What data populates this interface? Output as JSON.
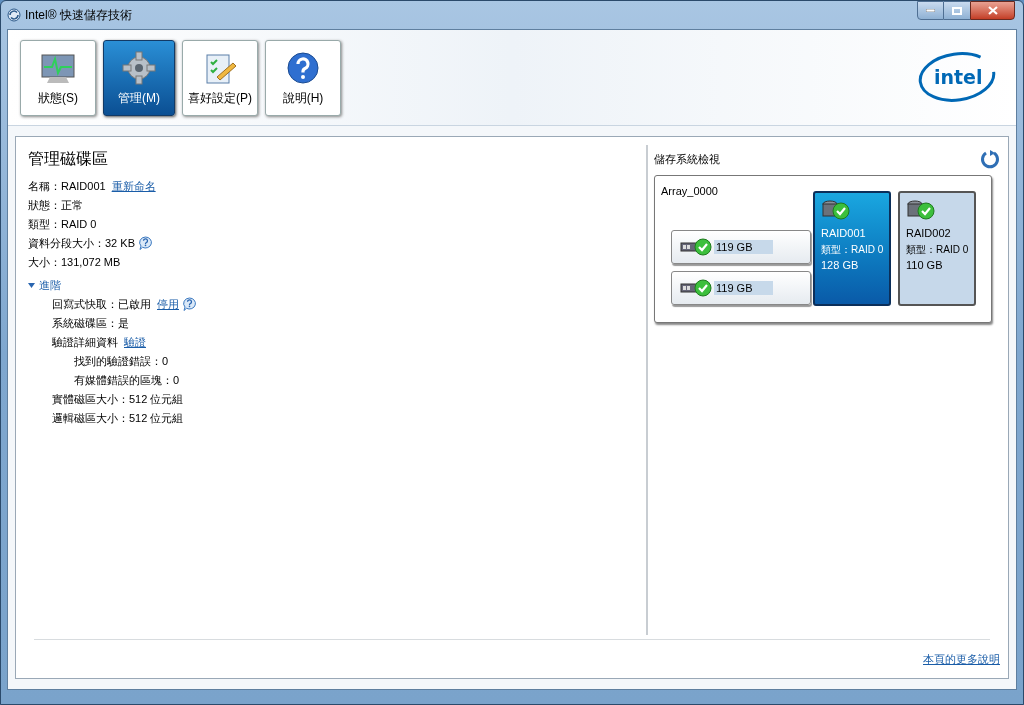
{
  "window": {
    "title": "Intel® 快速儲存技術"
  },
  "toolbar": [
    {
      "label": "狀態(S)",
      "kind": "monitor",
      "selected": false
    },
    {
      "label": "管理(M)",
      "kind": "gear",
      "selected": true
    },
    {
      "label": "喜好設定(P)",
      "kind": "clipboard",
      "selected": false
    },
    {
      "label": "說明(H)",
      "kind": "help",
      "selected": false
    }
  ],
  "volume_panel": {
    "title": "管理磁碟區",
    "rows": [
      {
        "text": "名稱：RAID001",
        "link": "重新命名",
        "help": false
      },
      {
        "text": "狀態：正常",
        "help": false
      },
      {
        "text": "類型：RAID 0",
        "help": false
      },
      {
        "text": "資料分段大小：32 KB",
        "help": true
      },
      {
        "text": "大小：131,072 MB",
        "help": false
      }
    ],
    "advanced": {
      "label": "進階",
      "expanded": true,
      "children": [
        {
          "text": "回寫式快取：已啟用",
          "link": "停用",
          "help": true
        },
        {
          "text": "系統磁碟區：是",
          "help": false
        },
        {
          "text": "驗證詳細資料",
          "link": "驗證",
          "help": false,
          "children": [
            {
              "text": "找到的驗證錯誤：0",
              "help": false
            },
            {
              "text": "有媒體錯誤的區塊：0",
              "help": false
            }
          ]
        },
        {
          "text": "實體磁區大小：512 位元組",
          "help": false
        },
        {
          "text": "邏輯磁區大小：512 位元組",
          "help": false
        }
      ]
    }
  },
  "storage_view": {
    "title": "儲存系統檢視",
    "array": {
      "name": "Array_0000",
      "disks": [
        {
          "size": "119 GB"
        },
        {
          "size": "119 GB"
        }
      ],
      "volumes": [
        {
          "name": "RAID001",
          "type": "類型：RAID 0",
          "size": "128 GB",
          "selected": true
        },
        {
          "name": "RAID002",
          "type": "類型：RAID 0",
          "size": "110 GB",
          "selected": false
        }
      ]
    }
  },
  "footer": {
    "link": "本頁的更多說明"
  },
  "logo": {
    "text": "intel"
  }
}
